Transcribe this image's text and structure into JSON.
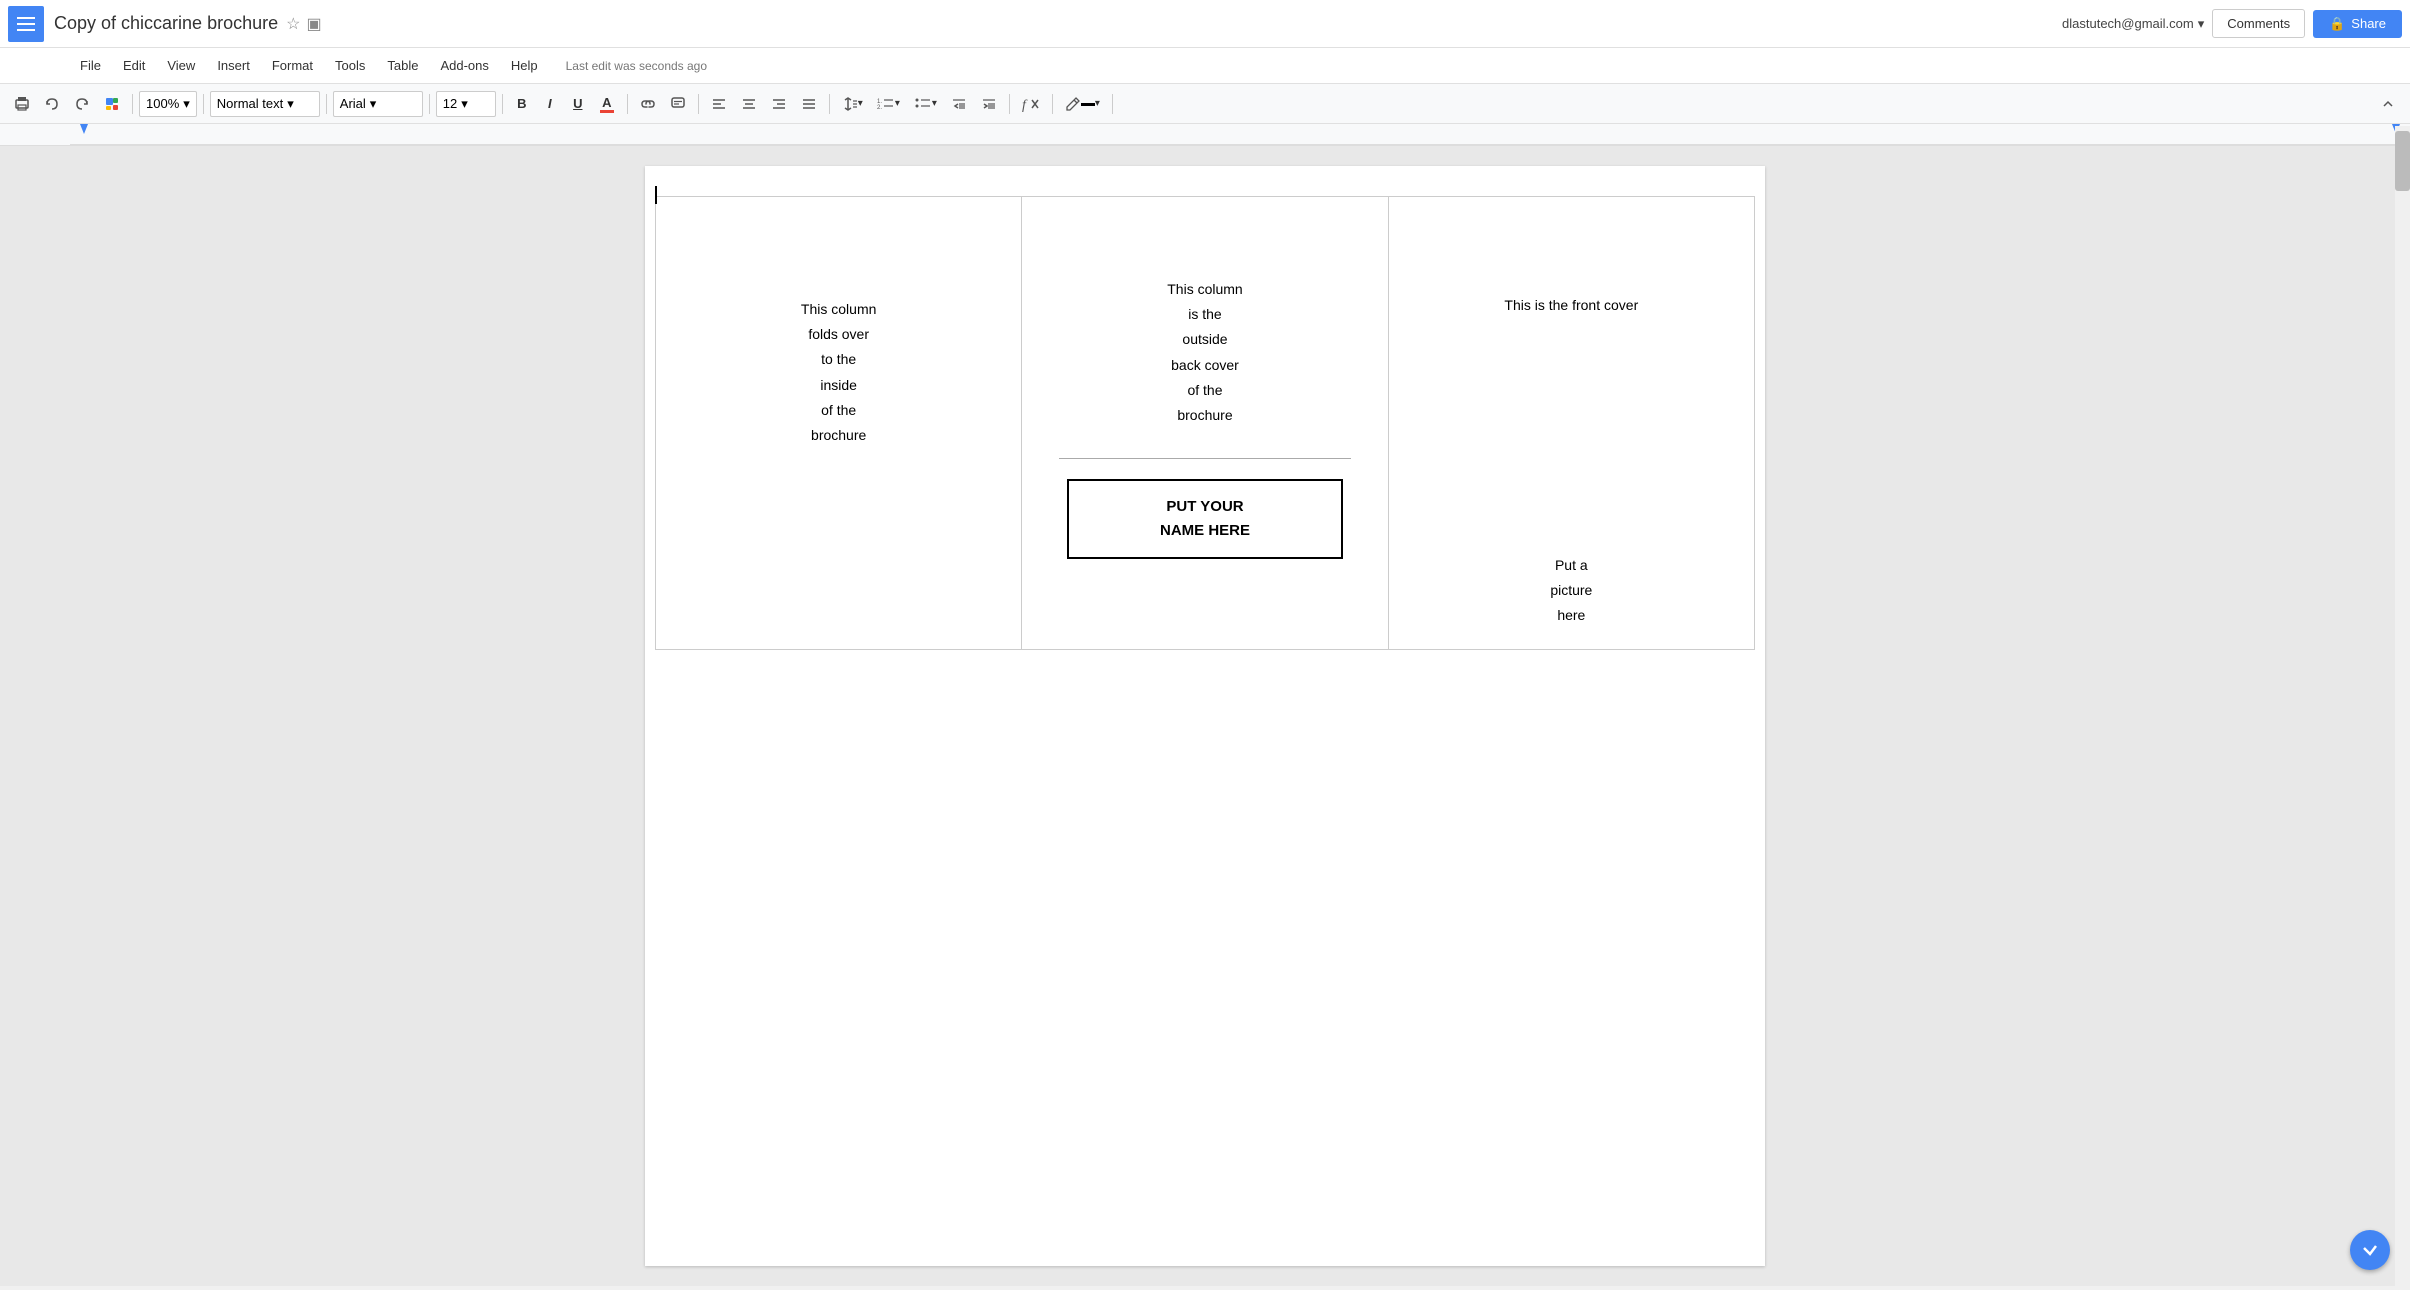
{
  "app": {
    "icon_label": "≡",
    "title": "Copy of chiccarine brochure",
    "star": "☆",
    "folder": "▣"
  },
  "user": {
    "email": "dlastutech@gmail.com",
    "dropdown_arrow": "▾"
  },
  "header_buttons": {
    "comments": "Comments",
    "share": "Share",
    "share_icon": "🔒"
  },
  "menu": {
    "items": [
      "File",
      "Edit",
      "View",
      "Insert",
      "Format",
      "Tools",
      "Table",
      "Add-ons",
      "Help"
    ]
  },
  "last_edit": "Last edit was seconds ago",
  "toolbar": {
    "print": "🖨",
    "undo": "↩",
    "redo": "↪",
    "paint": "🖌",
    "zoom": "100%",
    "style": "Normal text",
    "font": "Arial",
    "size": "12",
    "bold": "B",
    "italic": "I",
    "underline": "U",
    "text_color": "A",
    "link": "🔗",
    "comment": "💬",
    "align_left": "≡",
    "align_center": "≡",
    "align_right": "≡",
    "align_justify": "≡",
    "line_spacing": "↕",
    "numbered_list": "≔",
    "bulleted_list": "≔",
    "decrease_indent": "⇤",
    "increase_indent": "⇥",
    "clear_format": "ƒ",
    "pen": "✏",
    "collapse": "⌃"
  },
  "document": {
    "col1": {
      "text": "This column\nfolds over\nto the\ninside\nof the\nbrochure"
    },
    "col2": {
      "top_text": "This column\nis the\noutside\nback cover\nof the\nbrochure",
      "name_box_line1": "PUT YOUR",
      "name_box_line2": "NAME HERE"
    },
    "col3": {
      "front_cover": "This is the front cover",
      "picture": "Put a\npicture\nhere"
    }
  }
}
